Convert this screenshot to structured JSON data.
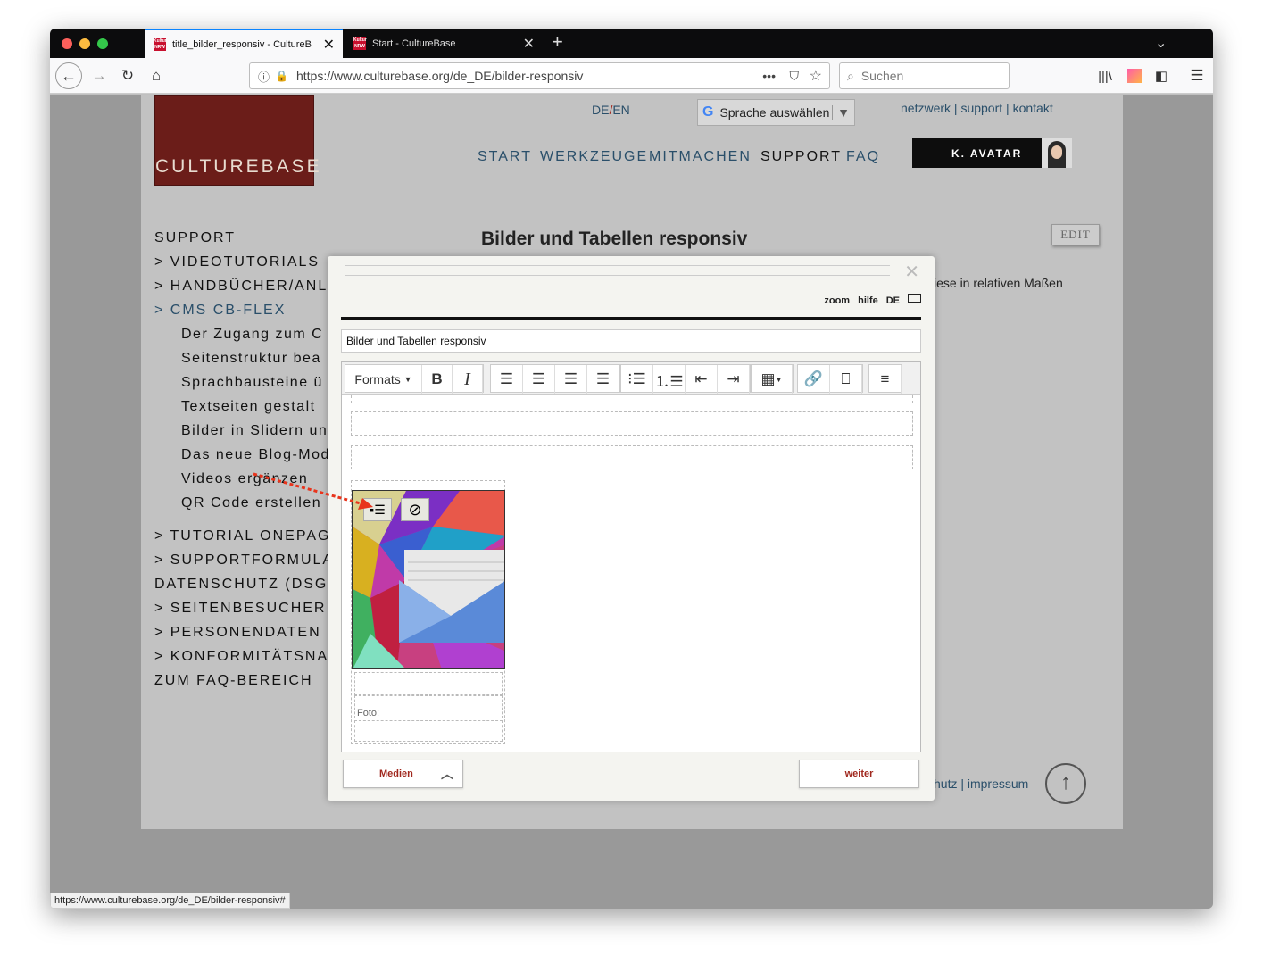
{
  "browser": {
    "tabs": [
      {
        "title": "title_bilder_responsiv - CultureB",
        "favicon": "NRW"
      },
      {
        "title": "Start - CultureBase",
        "favicon": "NRW"
      }
    ],
    "url": "https://www.culturebase.org/de_DE/bilder-responsiv",
    "search_placeholder": "Suchen",
    "status_url": "https://www.culturebase.org/de_DE/bilder-responsiv#"
  },
  "site": {
    "logo": "CULTUREBASE",
    "lang_de": "DE",
    "lang_sep": "/",
    "lang_en": "EN",
    "translate_label": "Sprache auswählen",
    "top_links": [
      "netzwerk",
      "support",
      "kontakt"
    ],
    "nav": [
      "START",
      "WERKZEUGE",
      "MITMACHEN",
      "SUPPORT",
      "FAQ"
    ],
    "avatar_label": "K. AVATAR",
    "page_title": "Bilder und Tabellen responsiv",
    "edit_label": "EDIT",
    "body_fragment": "iese in relativen Maßen",
    "footer_fragment": "hutz | impressum",
    "sidebar": [
      "SUPPORT",
      "> VIDEOTUTORIALS",
      "> HANDBÜCHER/ANLE",
      "> CMS CB-FLEX",
      "Der Zugang zum C",
      "Seitenstruktur bea",
      "Sprachbausteine ü",
      "Textseiten gestalt",
      "Bilder in Slidern un",
      "Das neue Blog-Mod",
      "Videos ergänzen",
      "QR Code erstellen",
      "> TUTORIAL ONEPAGE",
      "> SUPPORTFORMULAR",
      "DATENSCHUTZ (DSGV",
      "> SEITENBESUCHER",
      "> PERSONENDATEN",
      "> KONFORMITÄTSNAC",
      "ZUM FAQ-BEREICH"
    ]
  },
  "modal": {
    "zoom": "zoom",
    "hilfe": "hilfe",
    "lang": "DE",
    "title_value": "Bilder und Tabellen responsiv",
    "formats_label": "Formats",
    "foto_label": "Foto:",
    "medien_label": "Medien",
    "weiter_label": "weiter"
  },
  "colors": {
    "accent": "#2a4f6a",
    "brand": "#6b1d19",
    "button_text": "#a0281e",
    "arrow": "#e8341c"
  }
}
